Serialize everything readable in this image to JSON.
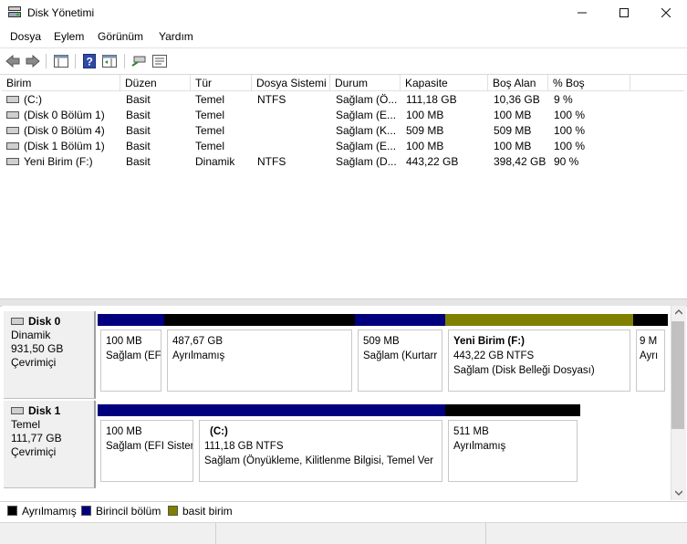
{
  "window": {
    "title": "Disk Yönetimi",
    "icon": "disk-management-icon"
  },
  "menu": [
    "Dosya",
    "Eylem",
    "Görünüm",
    "Yardım"
  ],
  "columns": [
    "Birim",
    "Düzen",
    "Tür",
    "Dosya Sistemi",
    "Durum",
    "Kapasite",
    "Boş Alan",
    "% Boş"
  ],
  "volumes": [
    {
      "name": "(C:)",
      "layout": "Basit",
      "type": "Temel",
      "fs": "NTFS",
      "status": "Sağlam (Ö...",
      "capacity": "111,18 GB",
      "free": "10,36 GB",
      "pct": "9 %"
    },
    {
      "name": "(Disk 0 Bölüm 1)",
      "layout": "Basit",
      "type": "Temel",
      "fs": "",
      "status": "Sağlam (E...",
      "capacity": "100 MB",
      "free": "100 MB",
      "pct": "100 %"
    },
    {
      "name": "(Disk 0 Bölüm 4)",
      "layout": "Basit",
      "type": "Temel",
      "fs": "",
      "status": "Sağlam (K...",
      "capacity": "509 MB",
      "free": "509 MB",
      "pct": "100 %"
    },
    {
      "name": "(Disk 1 Bölüm 1)",
      "layout": "Basit",
      "type": "Temel",
      "fs": "",
      "status": "Sağlam (E...",
      "capacity": "100 MB",
      "free": "100 MB",
      "pct": "100 %"
    },
    {
      "name": "Yeni Birim (F:)",
      "layout": "Basit",
      "type": "Dinamik",
      "fs": "NTFS",
      "status": "Sağlam (D...",
      "capacity": "443,22 GB",
      "free": "398,42 GB",
      "pct": "90 %"
    }
  ],
  "disks": [
    {
      "name": "Disk 0",
      "kind": "Dinamik",
      "size": "931,50 GB",
      "state": "Çevrimiçi",
      "partitions": [
        {
          "title": "",
          "line1": "100 MB",
          "line2": "Sağlam (EF"
        },
        {
          "title": "",
          "line1": "487,67 GB",
          "line2": "Ayrılmamış"
        },
        {
          "title": "",
          "line1": "509 MB",
          "line2": "Sağlam (Kurtarr"
        },
        {
          "title": "Yeni Birim  (F:)",
          "line1": "443,22 GB NTFS",
          "line2": "Sağlam (Disk Belleği Dosyası)"
        },
        {
          "title": "",
          "line1": "9 M",
          "line2": "Ayrı"
        }
      ]
    },
    {
      "name": "Disk 1",
      "kind": "Temel",
      "size": "111,77 GB",
      "state": "Çevrimiçi",
      "partitions": [
        {
          "title": "",
          "line1": "100 MB",
          "line2": "Sağlam (EFI Sister"
        },
        {
          "title": "(C:)",
          "line1": "111,18 GB NTFS",
          "line2": "Sağlam (Önyükleme, Kilitlenme Bilgisi, Temel Ver"
        },
        {
          "title": "",
          "line1": "511 MB",
          "line2": "Ayrılmamış"
        }
      ]
    }
  ],
  "legend": [
    {
      "label": "Ayrılmamış",
      "color": "#000000"
    },
    {
      "label": "Birincil bölüm",
      "color": "#00007f"
    },
    {
      "label": "basit birim",
      "color": "#808000"
    }
  ],
  "colors": {
    "primary": "#00007f",
    "unallocated": "#000000",
    "simple": "#808000"
  }
}
